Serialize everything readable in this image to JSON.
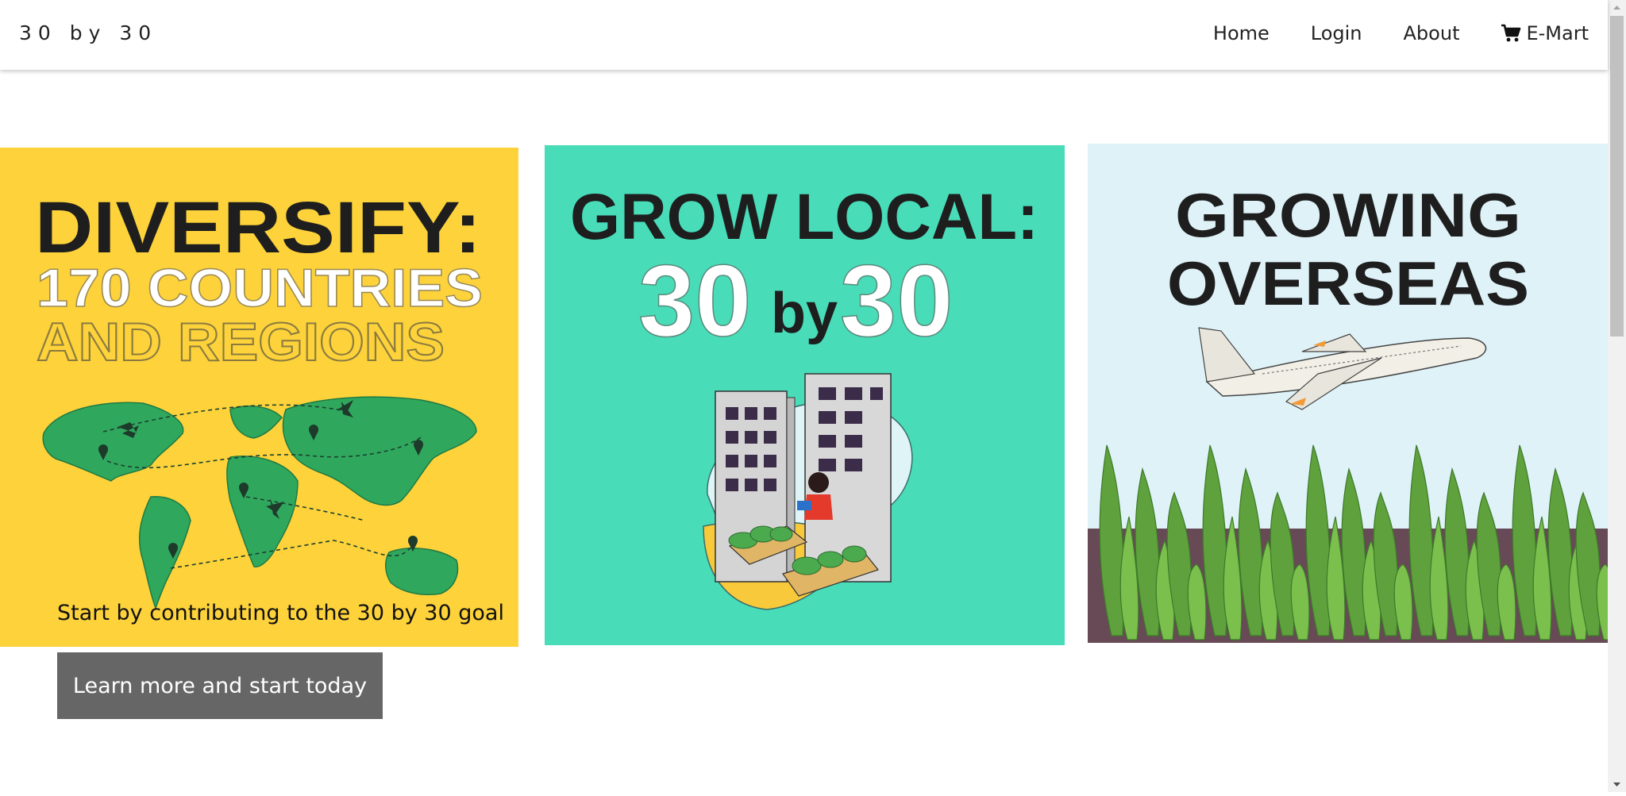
{
  "brand": "30 by 30",
  "nav": {
    "home": "Home",
    "login": "Login",
    "about": "About",
    "emart": "E-Mart"
  },
  "icons": {
    "cart": "cart-icon"
  },
  "slides": [
    {
      "heading": "DIVERSIFY:",
      "line2": "170 COUNTRIES",
      "line3": "AND REGIONS",
      "bg_color": "#fdd23a"
    },
    {
      "heading": "GROW LOCAL:",
      "num_left": "30",
      "by": "by",
      "num_right": "30",
      "bg_color": "#48dcb9"
    },
    {
      "heading_line1": "GROWING",
      "heading_line2": "OVERSEAS",
      "bg_color": "#def2f8"
    }
  ],
  "hero": {
    "tagline": "Start by contributing to the 30 by 30 goal",
    "cta_label": "Learn more and start today"
  }
}
